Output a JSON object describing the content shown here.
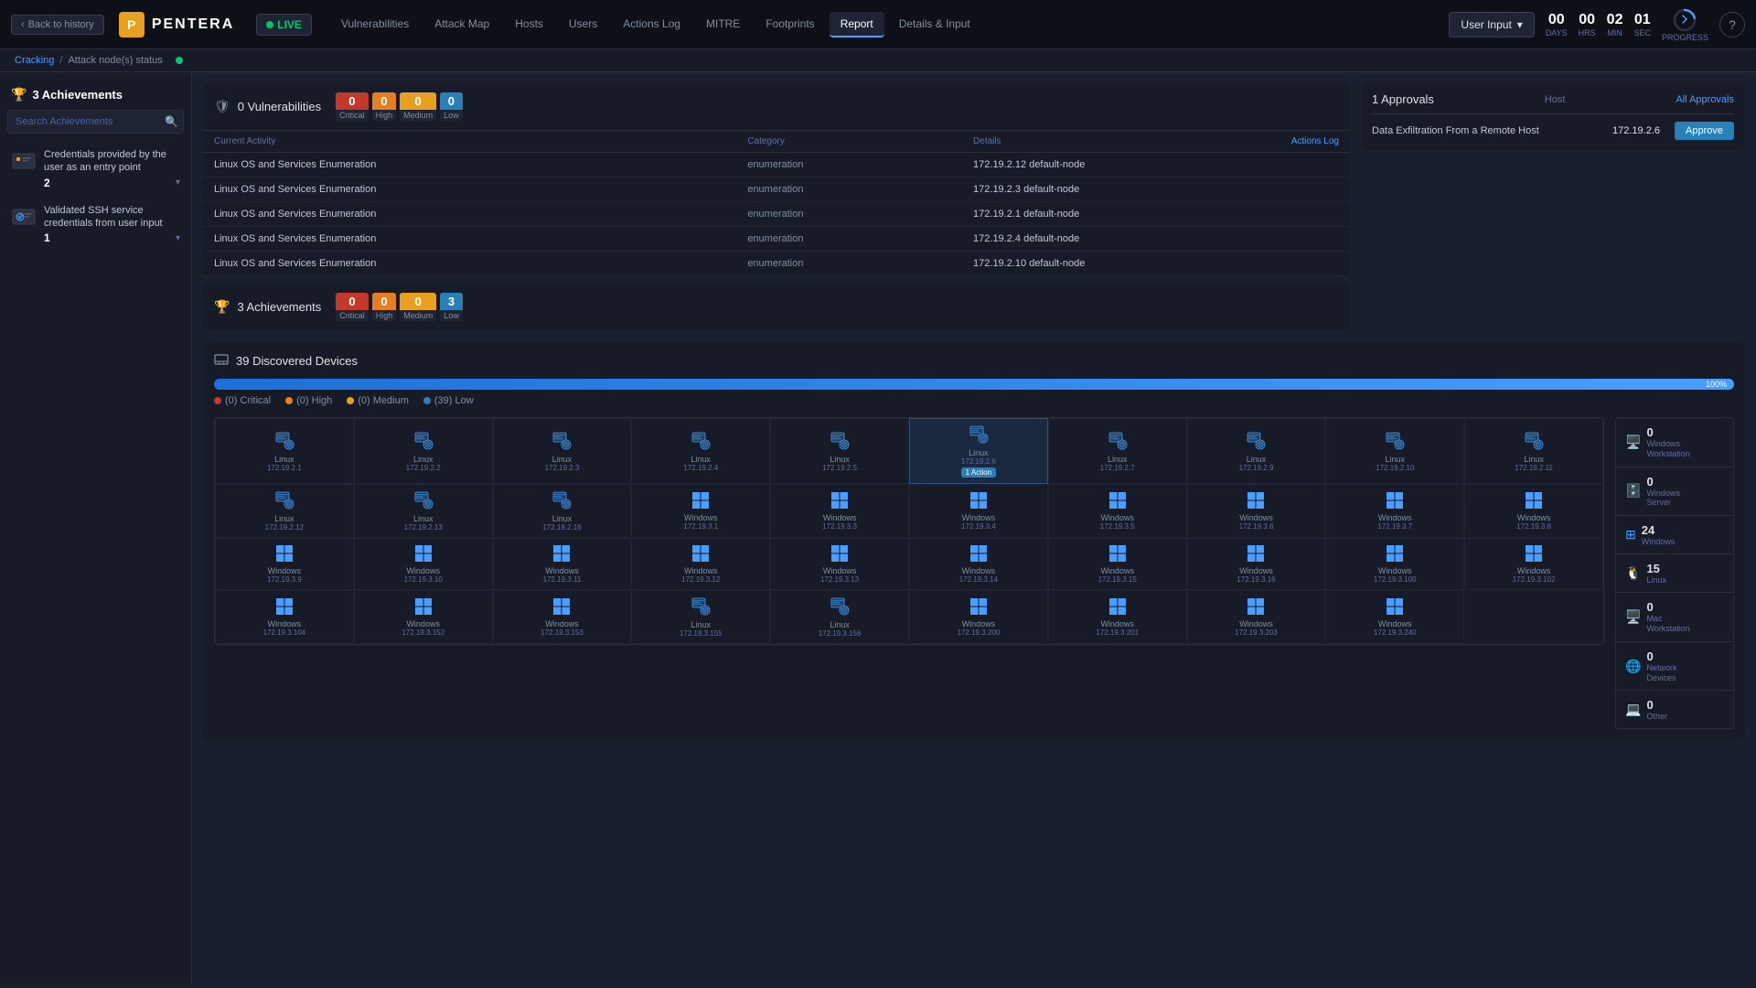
{
  "nav": {
    "back_label": "Back to history",
    "logo_text": "PENTERA",
    "live_label": "LIVE",
    "items": [
      {
        "label": "Vulnerabilities",
        "active": false
      },
      {
        "label": "Attack Map",
        "active": false
      },
      {
        "label": "Hosts",
        "active": false
      },
      {
        "label": "Users",
        "active": false
      },
      {
        "label": "Actions Log",
        "active": false
      },
      {
        "label": "MITRE",
        "active": false
      },
      {
        "label": "Footprints",
        "active": false
      },
      {
        "label": "Report",
        "active": true
      },
      {
        "label": "Details & Input",
        "active": false
      }
    ],
    "user_input_label": "User Input",
    "timer": {
      "days_val": "00",
      "hrs_val": "00",
      "min_val": "02",
      "sec_val": "01",
      "days_label": "DAYS",
      "hrs_label": "HRS",
      "min_label": "MIN",
      "sec_label": "SEC",
      "progress_label": "PROGRESS"
    }
  },
  "breadcrumb": {
    "cracking": "Cracking",
    "separator": "/",
    "current": "Attack node(s) status"
  },
  "sidebar": {
    "achievements_label": "3 Achievements",
    "search_placeholder": "Search Achievements",
    "items": [
      {
        "title": "Credentials provided by the user as an entry point",
        "count": "2",
        "expanded": false
      },
      {
        "title": "Validated SSH service credentials from user input",
        "count": "1",
        "expanded": false
      }
    ]
  },
  "vulnerabilities": {
    "title": "0 Vulnerabilities",
    "badges": {
      "critical": "0",
      "high": "0",
      "medium": "0",
      "low": "0"
    },
    "table_headers": [
      "Current Activity",
      "Category",
      "Details",
      ""
    ],
    "actions_log_label": "Actions Log",
    "rows": [
      {
        "activity": "Linux OS and Services Enumeration",
        "category": "enumeration",
        "details": "172.19.2.12 default-node"
      },
      {
        "activity": "Linux OS and Services Enumeration",
        "category": "enumeration",
        "details": "172.19.2.3 default-node"
      },
      {
        "activity": "Linux OS and Services Enumeration",
        "category": "enumeration",
        "details": "172.19.2.1 default-node"
      },
      {
        "activity": "Linux OS and Services Enumeration",
        "category": "enumeration",
        "details": "172.19.2.4 default-node"
      },
      {
        "activity": "Linux OS and Services Enumeration",
        "category": "enumeration",
        "details": "172.19.2.10 default-node"
      }
    ]
  },
  "achievements_section": {
    "title": "3 Achievements",
    "badges": {
      "critical": "0",
      "high": "0",
      "medium": "0",
      "low": "3"
    }
  },
  "approvals": {
    "title": "1 Approvals",
    "all_link": "All Approvals",
    "host_label": "Host",
    "row": {
      "text": "Data Exfiltration From a Remote Host",
      "host": "172.19.2.6",
      "approve_label": "Approve"
    }
  },
  "devices": {
    "title": "39 Discovered Devices",
    "progress_pct": "100%",
    "legend": [
      {
        "label": "(0) Critical",
        "type": "critical"
      },
      {
        "label": "(0) High",
        "type": "high"
      },
      {
        "label": "(0) Medium",
        "type": "medium"
      },
      {
        "label": "(39) Low",
        "type": "low"
      }
    ],
    "categories": [
      {
        "count": "0",
        "name": "Windows\nWorkstation",
        "icon": "🖥"
      },
      {
        "count": "0",
        "name": "Windows\nServer",
        "icon": "🗄"
      },
      {
        "count": "24",
        "name": "Windows",
        "icon": "⊞"
      },
      {
        "count": "15",
        "name": "Linux",
        "icon": "🐧"
      },
      {
        "count": "0",
        "name": "Mac\nWorkstation",
        "icon": "🖥"
      },
      {
        "count": "0",
        "name": "Network\nDevices",
        "icon": "🌐"
      },
      {
        "count": "0",
        "name": "Other",
        "icon": "💻"
      }
    ],
    "grid": [
      {
        "type": "linux",
        "name": "Linux",
        "ip": "172.19.2.1"
      },
      {
        "type": "linux",
        "name": "Linux",
        "ip": "172.19.2.2"
      },
      {
        "type": "linux",
        "name": "Linux",
        "ip": "172.19.2.3"
      },
      {
        "type": "linux",
        "name": "Linux",
        "ip": "172.19.2.4"
      },
      {
        "type": "linux",
        "name": "Linux",
        "ip": "172.19.2.5"
      },
      {
        "type": "linux",
        "name": "Linux",
        "ip": "172.19.2.6",
        "action": "1 Action"
      },
      {
        "type": "linux",
        "name": "Linux",
        "ip": "172.19.2.7"
      },
      {
        "type": "linux",
        "name": "Linux",
        "ip": "172.19.2.9"
      },
      {
        "type": "linux",
        "name": "Linux",
        "ip": "172.19.2.10"
      },
      {
        "type": "linux",
        "name": "Linux",
        "ip": "172.19.2.11"
      },
      {
        "type": "linux",
        "name": "Linux",
        "ip": "172.19.2.12"
      },
      {
        "type": "linux",
        "name": "Linux",
        "ip": "172.19.2.13"
      },
      {
        "type": "linux",
        "name": "Linux",
        "ip": "172.19.2.16"
      },
      {
        "type": "windows",
        "name": "Windows",
        "ip": "172.19.3.1"
      },
      {
        "type": "windows",
        "name": "Windows",
        "ip": "172.19.3.3"
      },
      {
        "type": "windows",
        "name": "Windows",
        "ip": "172.19.3.4"
      },
      {
        "type": "windows",
        "name": "Windows",
        "ip": "172.19.3.5"
      },
      {
        "type": "windows",
        "name": "Windows",
        "ip": "172.19.3.6"
      },
      {
        "type": "windows",
        "name": "Windows",
        "ip": "172.19.3.7"
      },
      {
        "type": "windows",
        "name": "Windows",
        "ip": "172.19.3.8"
      },
      {
        "type": "windows",
        "name": "Windows",
        "ip": "172.19.3.9"
      },
      {
        "type": "windows",
        "name": "Windows",
        "ip": "172.19.3.10"
      },
      {
        "type": "windows",
        "name": "Windows",
        "ip": "172.19.3.11"
      },
      {
        "type": "windows",
        "name": "Windows",
        "ip": "172.19.3.12"
      },
      {
        "type": "windows",
        "name": "Windows",
        "ip": "172.19.3.13"
      },
      {
        "type": "windows",
        "name": "Windows",
        "ip": "172.19.3.14"
      },
      {
        "type": "windows",
        "name": "Windows",
        "ip": "172.19.3.15"
      },
      {
        "type": "windows",
        "name": "Windows",
        "ip": "172.19.3.16"
      },
      {
        "type": "windows",
        "name": "Windows",
        "ip": "172.19.3.100"
      },
      {
        "type": "windows",
        "name": "Windows",
        "ip": "172.19.3.102"
      },
      {
        "type": "windows",
        "name": "Windows",
        "ip": "172.19.3.104"
      },
      {
        "type": "windows",
        "name": "Windows",
        "ip": "172.19.3.152"
      },
      {
        "type": "windows",
        "name": "Windows",
        "ip": "172.19.3.153"
      },
      {
        "type": "linux",
        "name": "Linux",
        "ip": "172.19.3.155"
      },
      {
        "type": "linux",
        "name": "Linux",
        "ip": "172.19.3.156"
      },
      {
        "type": "windows",
        "name": "Windows",
        "ip": "172.19.3.200"
      },
      {
        "type": "windows",
        "name": "Windows",
        "ip": "172.19.3.201"
      },
      {
        "type": "windows",
        "name": "Windows",
        "ip": "172.19.3.203"
      },
      {
        "type": "windows",
        "name": "Windows",
        "ip": "172.19.3.240"
      }
    ]
  }
}
